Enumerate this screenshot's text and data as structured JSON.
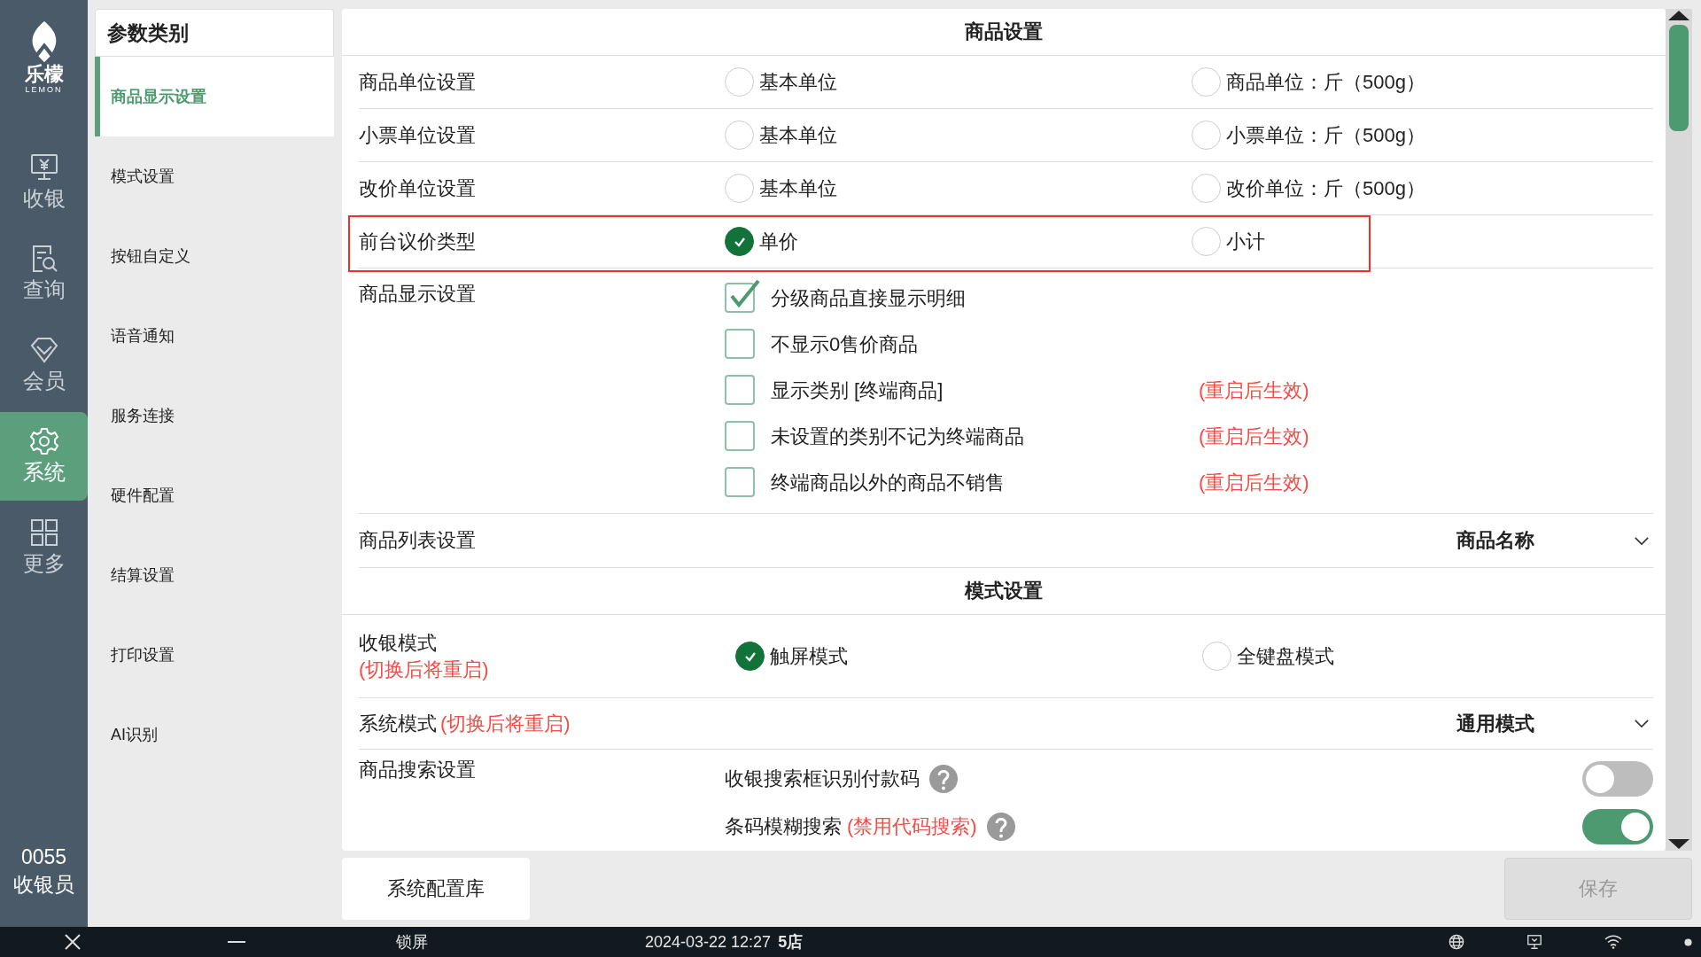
{
  "logo": {
    "name": "乐檬",
    "sub": "LEMON"
  },
  "nav": [
    {
      "label": "收银",
      "selected": false
    },
    {
      "label": "查询",
      "selected": false
    },
    {
      "label": "会员",
      "selected": false
    },
    {
      "label": "系统",
      "selected": true
    },
    {
      "label": "更多",
      "selected": false
    }
  ],
  "operator": {
    "id": "0055",
    "role": "收银员"
  },
  "categories": {
    "title": "参数类别",
    "items": [
      {
        "label": "商品显示设置",
        "selected": true
      },
      {
        "label": "模式设置",
        "selected": false
      },
      {
        "label": "按钮自定义",
        "selected": false
      },
      {
        "label": "语音通知",
        "selected": false
      },
      {
        "label": "服务连接",
        "selected": false
      },
      {
        "label": "硬件配置",
        "selected": false
      },
      {
        "label": "结算设置",
        "selected": false
      },
      {
        "label": "打印设置",
        "selected": false
      },
      {
        "label": "AI识别",
        "selected": false
      }
    ]
  },
  "sections": [
    {
      "title": "商品设置",
      "rows": [
        {
          "kind": "radio",
          "label": "商品单位设置",
          "highlighted": false,
          "options": [
            {
              "label": "基本单位",
              "selected": false
            },
            {
              "label": "商品单位：斤（500g）",
              "selected": false
            }
          ]
        },
        {
          "kind": "radio",
          "label": "小票单位设置",
          "highlighted": false,
          "options": [
            {
              "label": "基本单位",
              "selected": false
            },
            {
              "label": "小票单位：斤（500g）",
              "selected": false
            }
          ]
        },
        {
          "kind": "radio",
          "label": "改价单位设置",
          "highlighted": false,
          "options": [
            {
              "label": "基本单位",
              "selected": false
            },
            {
              "label": "改价单位：斤（500g）",
              "selected": false
            }
          ]
        },
        {
          "kind": "radio",
          "label": "前台议价类型",
          "highlighted": true,
          "options": [
            {
              "label": "单价",
              "selected": true
            },
            {
              "label": "小计",
              "selected": false
            }
          ]
        },
        {
          "kind": "checks",
          "label": "商品显示设置",
          "options": [
            {
              "label": "分级商品直接显示明细",
              "checked": true
            },
            {
              "label": "不显示0售价商品",
              "checked": false
            },
            {
              "label": "显示类别 [终端商品]",
              "checked": false,
              "note": "(重启后生效)"
            },
            {
              "label": "未设置的类别不记为终端商品",
              "checked": false,
              "note": "(重启后生效)"
            },
            {
              "label": "终端商品以外的商品不销售",
              "checked": false,
              "note": "(重启后生效)"
            }
          ]
        },
        {
          "kind": "select",
          "label": "商品列表设置",
          "value": "商品名称"
        }
      ]
    },
    {
      "title": "模式设置",
      "rows": [
        {
          "kind": "radio",
          "label": "收银模式",
          "note": "(切换后将重启)",
          "highlighted": false,
          "options": [
            {
              "label": "触屏模式",
              "selected": true
            },
            {
              "label": "全键盘模式",
              "selected": false
            }
          ]
        },
        {
          "kind": "select",
          "label": "系统模式",
          "note": "(切换后将重启)",
          "value": "通用模式"
        },
        {
          "kind": "toggles",
          "label": "商品搜索设置",
          "options": [
            {
              "label": "收银搜索框识别付款码",
              "on": false
            },
            {
              "label": "条码模糊搜索",
              "note": "(禁用代码搜索)",
              "on": true
            }
          ]
        }
      ]
    }
  ],
  "footer": {
    "library_button": "系统配置库",
    "save_button": {
      "label": "保存",
      "disabled": true
    }
  },
  "taskbar": {
    "lock": "锁屏",
    "datetime": "2024-03-22 12:27",
    "store": "5店"
  }
}
